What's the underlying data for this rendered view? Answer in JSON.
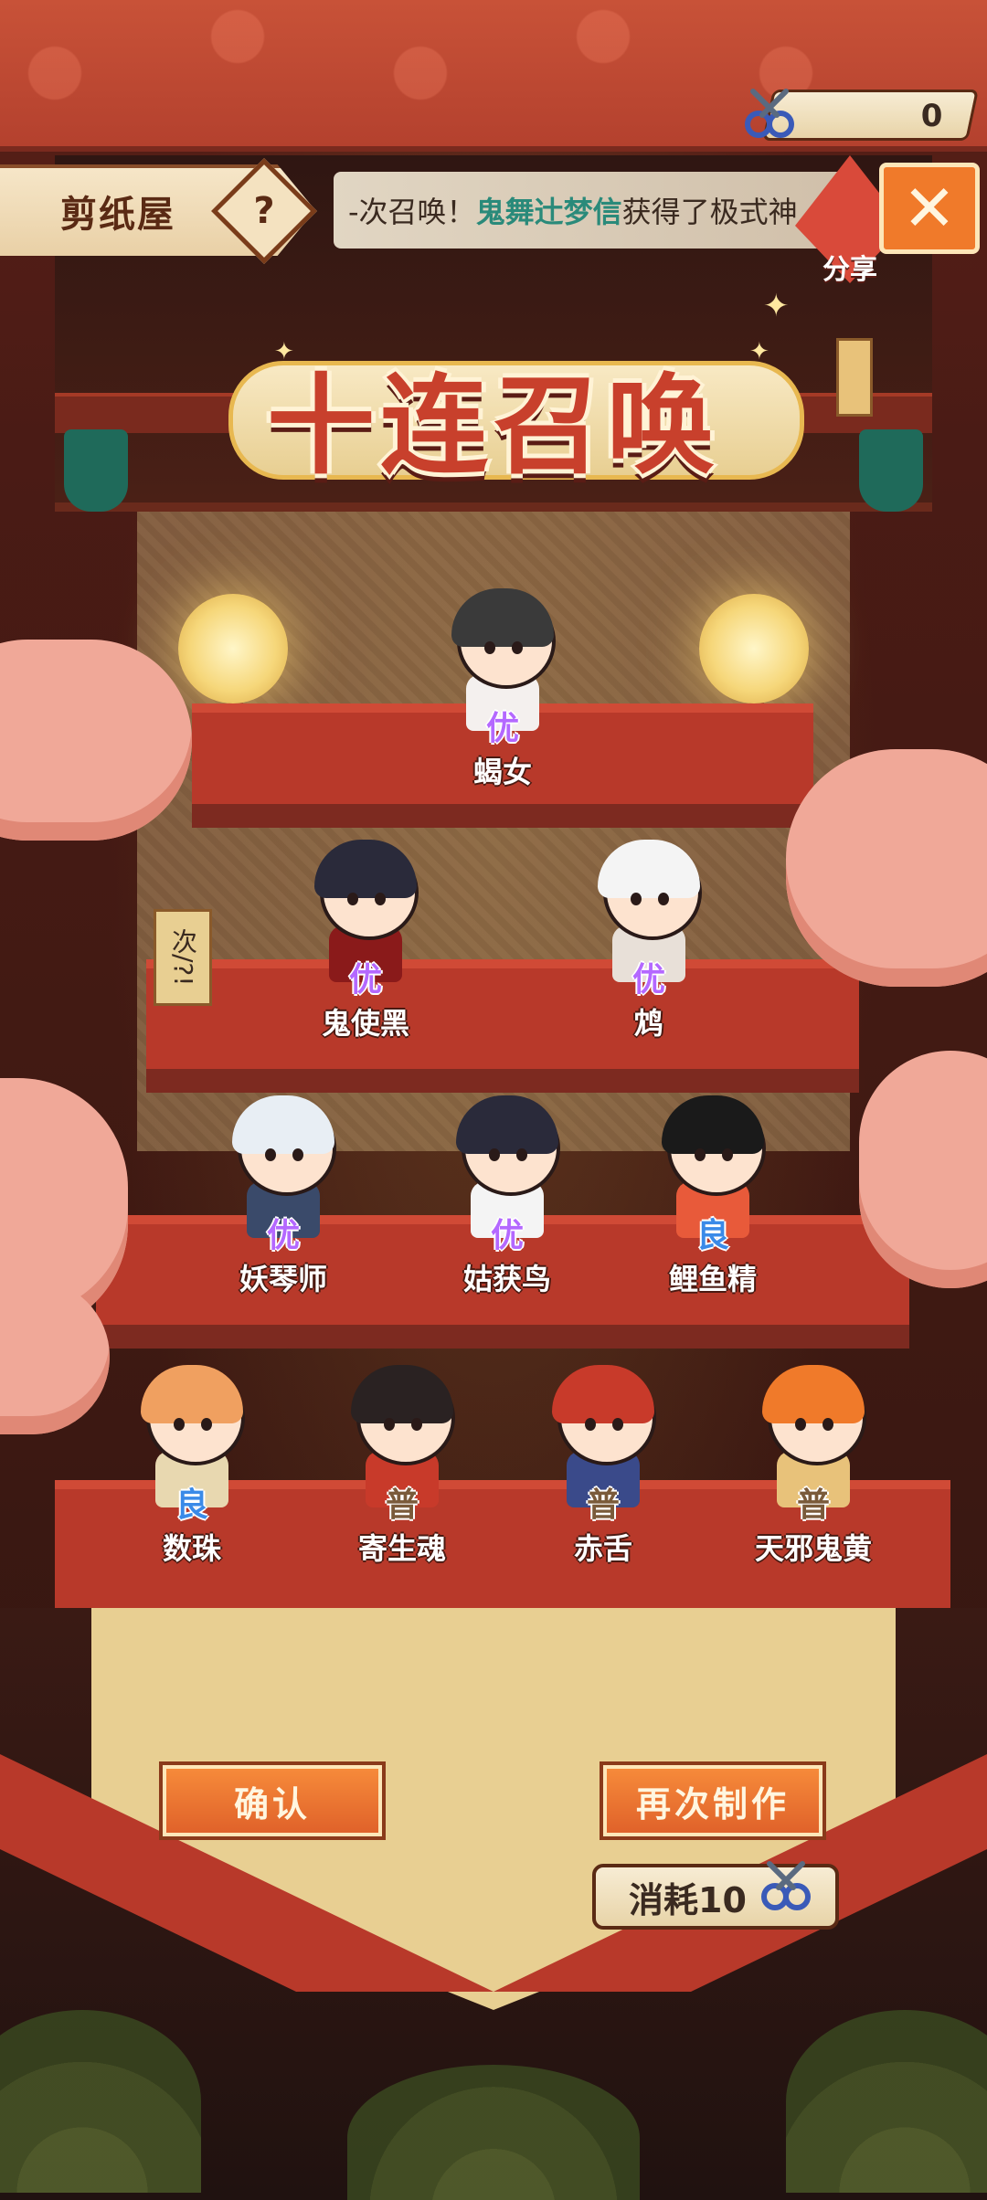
{
  "header": {
    "title": "剪纸屋",
    "help_icon": "?",
    "notice_prefix": "-次召唤！",
    "notice_player": "鬼舞辻梦信",
    "notice_suffix": "获得了极式神",
    "close_icon": "✕",
    "share_label": "分享"
  },
  "currency": {
    "value": "0",
    "icon": "scissors-icon"
  },
  "banner": {
    "title": "十连召唤"
  },
  "summons": [
    {
      "name": "蝎女",
      "rarity": "优"
    },
    {
      "name": "鬼使黑",
      "rarity": "优"
    },
    {
      "name": "鸩",
      "rarity": "优"
    },
    {
      "name": "妖琴师",
      "rarity": "优"
    },
    {
      "name": "姑获鸟",
      "rarity": "优"
    },
    {
      "name": "鲤鱼精",
      "rarity": "良"
    },
    {
      "name": "数珠",
      "rarity": "良"
    },
    {
      "name": "寄生魂",
      "rarity": "普"
    },
    {
      "name": "赤舌",
      "rarity": "普"
    },
    {
      "name": "天邪鬼黄",
      "rarity": "普"
    }
  ],
  "sign": {
    "text": "次/?!"
  },
  "actions": {
    "confirm_label": "确认",
    "again_label": "再次制作",
    "cost_label": "消耗10"
  },
  "colors": {
    "rarity_you": "#b468ff",
    "rarity_liang": "#3a8ae8",
    "rarity_pu": "#7a5a3a",
    "button": "#f07a2a"
  }
}
